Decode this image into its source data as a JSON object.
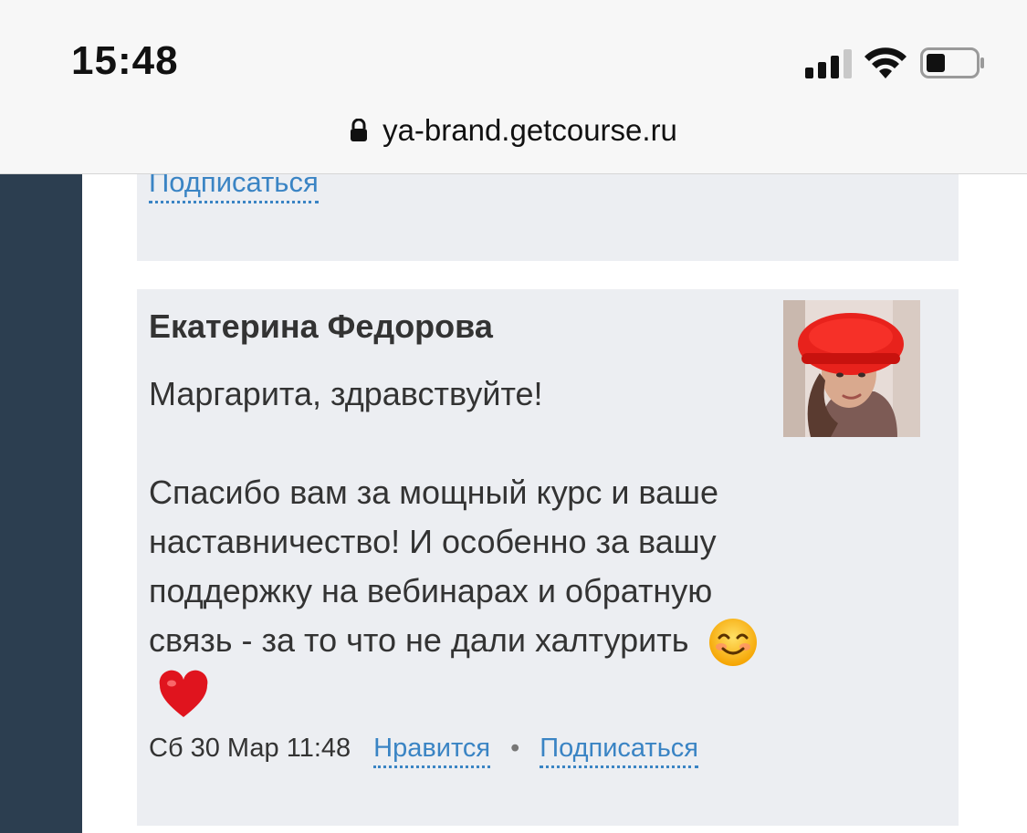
{
  "status_bar": {
    "time": "15:48"
  },
  "browser": {
    "url": "ya-brand.getcourse.ru"
  },
  "previous_comment": {
    "subscribe_label": "Подписаться"
  },
  "comment": {
    "author": "Екатерина Федорова",
    "greeting": "Маргарита, здравствуйте!",
    "body": "Спасибо вам за мощный курс и ваше наставничество! И особенно за вашу поддержку на вебинарах и обратную связь - за то что не дали халтурить",
    "date": "Сб 30 Мар 11:48",
    "like_label": "Нравится",
    "separator": "•",
    "subscribe_label": "Подписаться"
  },
  "colors": {
    "sidebar": "#2c3e50",
    "card_bg": "#eceef2",
    "link": "#3a84c4"
  }
}
